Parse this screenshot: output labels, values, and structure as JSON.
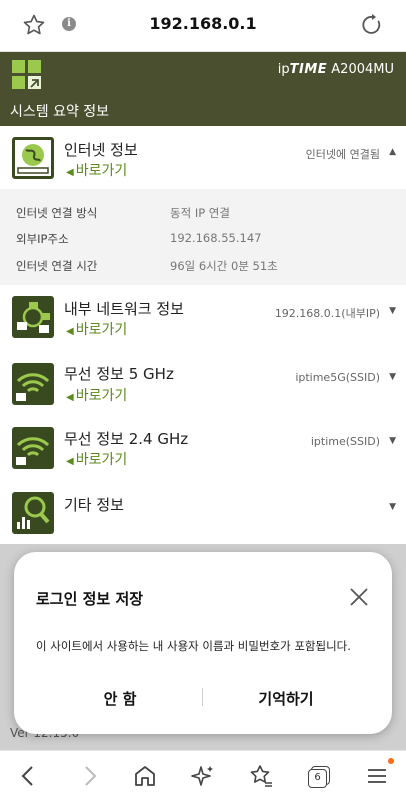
{
  "browser": {
    "url": "192.168.0.1",
    "info_glyph": "i",
    "tab_count": "6"
  },
  "router": {
    "brand_prefix": "ip",
    "brand_name": "TIME",
    "model": "A2004MU",
    "page_title": "시스템 요약 정보"
  },
  "sections": {
    "internet": {
      "title": "인터넷 정보",
      "link": "바로가기",
      "status": "인터넷에 연결됨",
      "expanded": true,
      "details": [
        {
          "label": "인터넷 연결 방식",
          "value": "동적 IP 연결"
        },
        {
          "label": "외부IP주소",
          "value": "192.168.55.147"
        },
        {
          "label": "인터넷 연결 시간",
          "value": "96일 6시간 0분 51초"
        }
      ]
    },
    "network": {
      "title": "내부 네트워크 정보",
      "link": "바로가기",
      "status": "192.168.0.1(내부IP)"
    },
    "wifi5": {
      "title": "무선 정보 5 GHz",
      "link": "바로가기",
      "status": "iptime5G(SSID)"
    },
    "wifi24": {
      "title": "무선 정보 2.4 GHz",
      "link": "바로가기",
      "status": "iptime(SSID)"
    },
    "other": {
      "title": "기타 정보"
    }
  },
  "footer": {
    "version": "Ver 12.15.0"
  },
  "dialog": {
    "title": "로그인 정보 저장",
    "message": "이 사이트에서 사용하는 내 사용자 이름과 비밀번호가 포함됩니다.",
    "decline_label": "안 함",
    "accept_label": "기억하기"
  },
  "colors": {
    "header_bg": "#4a4f2f",
    "icon_bg": "#3a4a20",
    "accent_green": "#9ac94d",
    "link_green": "#5b8a1e",
    "notification_dot": "#ff6a1a"
  },
  "icons": {
    "bookmark": "star-outline-icon",
    "site_info": "info-icon",
    "reload": "reload-icon",
    "internet": "globe-icon",
    "network": "network-icon",
    "wifi": "wifi-icon",
    "other": "magnifier-chart-icon",
    "close": "close-icon",
    "nav_back": "back-arrow-icon",
    "nav_forward": "forward-arrow-icon",
    "nav_home": "home-icon",
    "nav_sparkle": "sparkle-icon",
    "nav_favorites": "star-list-icon",
    "nav_tabs": "tabs-icon",
    "nav_menu": "menu-icon"
  }
}
